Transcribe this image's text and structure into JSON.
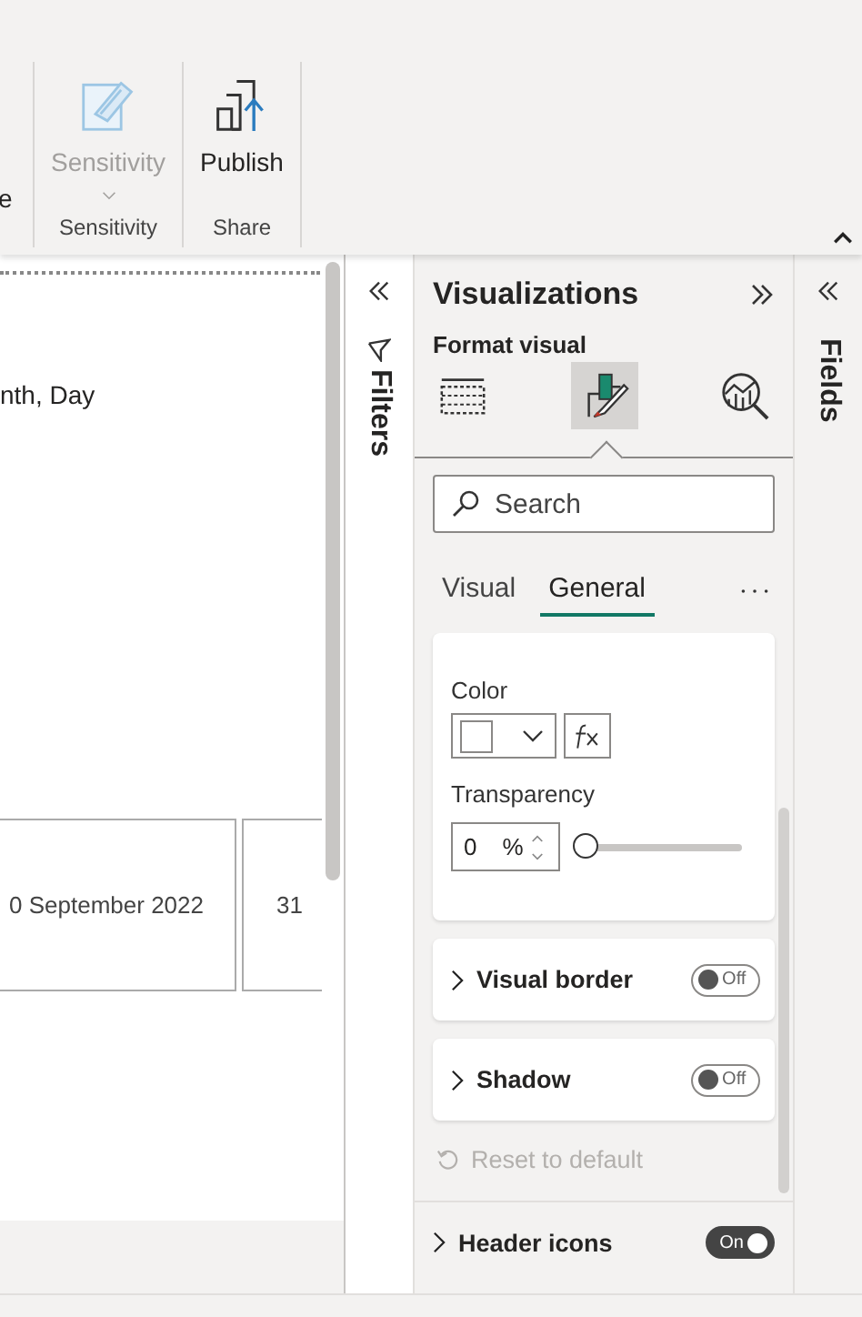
{
  "ribbon": {
    "cut_label": "e",
    "groups": [
      {
        "label": "Sensitivity",
        "buttons": [
          {
            "label": "Sensitivity",
            "kind": "sensitivity",
            "disabled": true,
            "dropdown": true
          }
        ]
      },
      {
        "label": "Share",
        "buttons": [
          {
            "label": "Publish",
            "kind": "publish",
            "disabled": false,
            "dropdown": false
          }
        ]
      }
    ]
  },
  "canvas": {
    "subtitle": "nth, Day",
    "cards": [
      "0 September 2022",
      "31"
    ]
  },
  "filters_pane": {
    "title": "Filters"
  },
  "visualizations": {
    "title": "Visualizations",
    "subtitle": "Format visual",
    "view_tabs": [
      {
        "kind": "build",
        "selected": false
      },
      {
        "kind": "format",
        "selected": true
      },
      {
        "kind": "analytics",
        "selected": false
      }
    ],
    "search": {
      "placeholder": "Search"
    },
    "tabs": [
      {
        "label": "Visual",
        "selected": false
      },
      {
        "label": "General",
        "selected": true
      }
    ],
    "background": {
      "color_label": "Color",
      "transparency_label": "Transparency",
      "transparency_value": "0",
      "unit": "%",
      "level": 0
    },
    "sections": [
      {
        "label": "Visual border",
        "on": false,
        "toggle": "Off"
      },
      {
        "label": "Shadow",
        "on": false,
        "toggle": "Off"
      }
    ],
    "reset": {
      "label": "Reset to default",
      "disabled": true
    },
    "header_icons": {
      "label": "Header icons",
      "on": true,
      "toggle": "On"
    }
  },
  "fields_pane": {
    "title": "Fields"
  }
}
